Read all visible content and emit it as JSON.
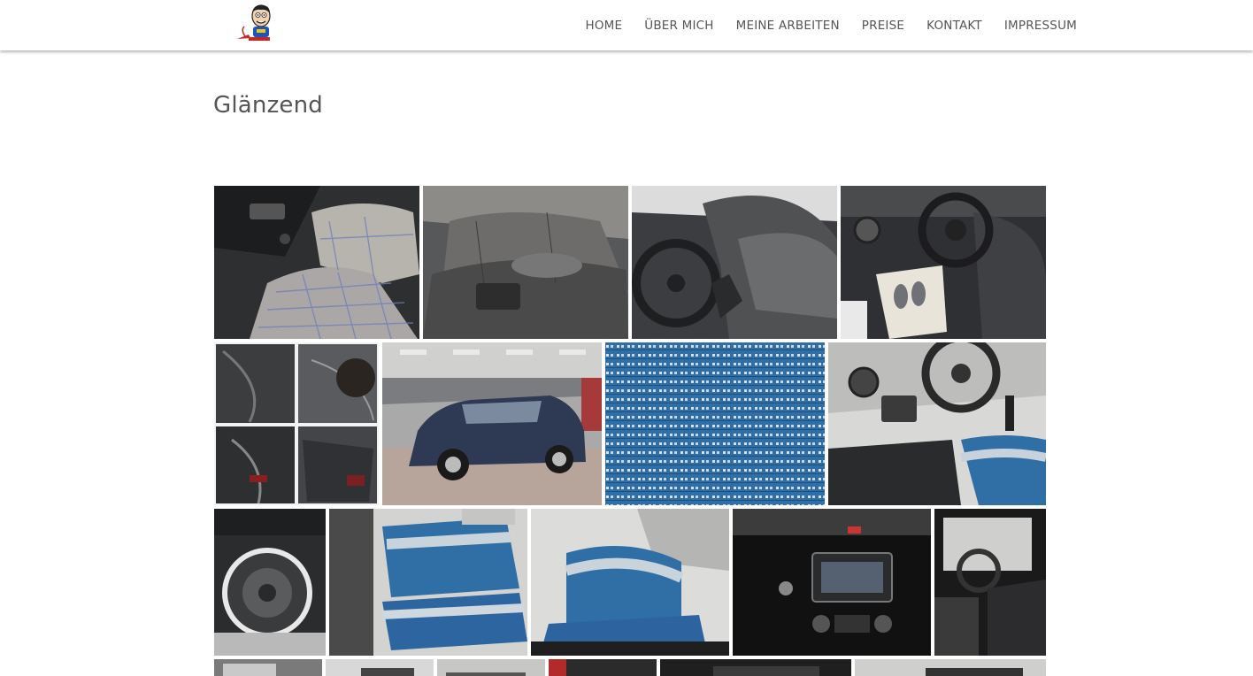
{
  "header": {
    "logo_alt": "Logo",
    "nav": [
      {
        "label": "HOME"
      },
      {
        "label": "ÜBER MICH"
      },
      {
        "label": "MEINE ARBEITEN"
      },
      {
        "label": "PREISE"
      },
      {
        "label": "KONTAKT"
      },
      {
        "label": "IMPRESSUM"
      }
    ]
  },
  "main": {
    "title": "Glänzend"
  },
  "gallery": {
    "images": [
      {
        "subject": "car-interior-plaid-seats"
      },
      {
        "subject": "car-rear-bench-seat"
      },
      {
        "subject": "car-front-seat-steering-wheel"
      },
      {
        "subject": "car-interior-floor-mat"
      },
      {
        "subject": "car-paint-scratches-collage"
      },
      {
        "subject": "vintage-car-parking-garage"
      },
      {
        "subject": "blue-seat-fabric-closeup"
      },
      {
        "subject": "car-dashboard-blue-seat"
      },
      {
        "subject": "car-trunk-spare-wheel"
      },
      {
        "subject": "car-rear-blue-seats"
      },
      {
        "subject": "car-front-blue-seat"
      },
      {
        "subject": "car-center-console-radio"
      },
      {
        "subject": "car-interior-door-view"
      },
      {
        "subject": "car-interior-partial"
      },
      {
        "subject": "car-interior-partial"
      },
      {
        "subject": "car-interior-partial"
      },
      {
        "subject": "car-interior-partial"
      },
      {
        "subject": "car-interior-partial"
      },
      {
        "subject": "car-interior-partial"
      }
    ]
  },
  "colors": {
    "nav_text": "#555555",
    "title_text": "#555555",
    "seat_blue": "#2f6fa6",
    "background": "#ffffff"
  }
}
